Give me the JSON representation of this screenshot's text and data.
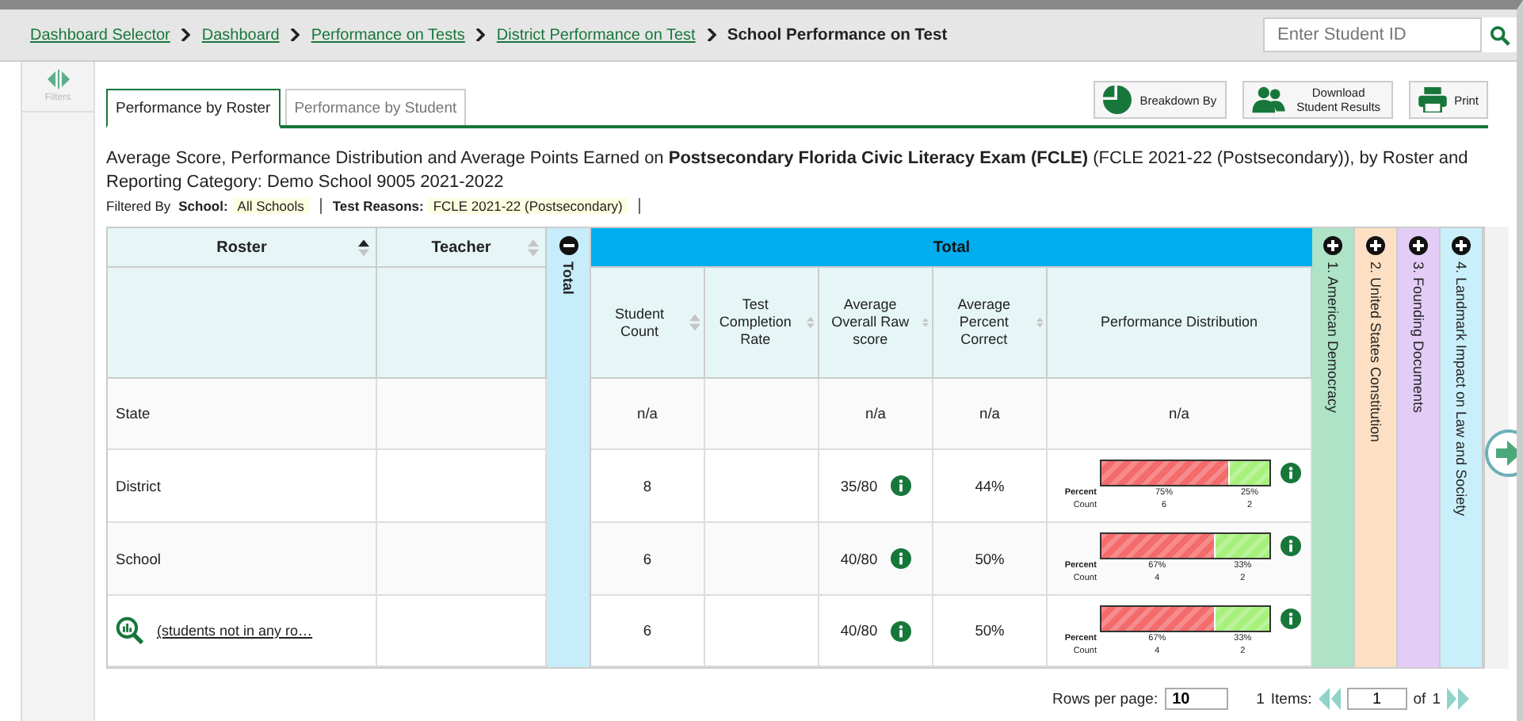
{
  "breadcrumb": [
    {
      "label": "Dashboard Selector",
      "kind": "link"
    },
    {
      "label": "Dashboard",
      "kind": "link"
    },
    {
      "label": "Performance on Tests",
      "kind": "link"
    },
    {
      "label": "District Performance on Test",
      "kind": "link"
    },
    {
      "label": "School Performance on Test",
      "kind": "current"
    }
  ],
  "student_search": {
    "placeholder": "Enter Student ID"
  },
  "sidebar": {
    "label": "Filters"
  },
  "tabs": [
    {
      "label": "Performance by Roster",
      "selected": true
    },
    {
      "label": "Performance by Student",
      "selected": false
    }
  ],
  "toolbar": [
    {
      "label": "Breakdown By",
      "kind": "breakdown"
    },
    {
      "label": "Download Student Results",
      "kind": "download"
    },
    {
      "label": "Print",
      "kind": "print"
    }
  ],
  "title": "Average Score, Performance Distribution and Average Points Earned on **Postsecondary Florida Civic Literacy Exam (FCLE)** (FCLE 2021-22 (Postsecondary)), by Roster and Reporting Category: Demo School 9005 2021-2022",
  "filters": {
    "label": "Filtered By",
    "items": [
      {
        "label": "School:",
        "value": "All Schools"
      },
      {
        "label": "Test Reasons:",
        "value": "FCLE 2021-22 (Postsecondary)"
      }
    ]
  },
  "table": {
    "roster_column": {
      "label": "Roster",
      "sorted": true
    },
    "teacher_column": {
      "label": "Teacher",
      "sorted": false
    },
    "total_group": {
      "label": "Total",
      "strip_label": "Total",
      "expanded": true
    },
    "columns": [
      {
        "label": "Student Count",
        "sortable": true
      },
      {
        "label": "Test Completion Rate",
        "sortable": true
      },
      {
        "label": "Average Overall Raw score",
        "sortable": true
      },
      {
        "label": "Average Percent Correct",
        "sortable": true
      },
      {
        "label": "Performance Distribution",
        "sortable": false
      }
    ],
    "categories": [
      {
        "label": "1. American Democracy",
        "color": "#aee3c8",
        "expanded": false
      },
      {
        "label": "2. United States Constitution",
        "color": "#fde0c4",
        "expanded": false
      },
      {
        "label": "3. Founding Documents",
        "color": "#e3cdf7",
        "expanded": false
      },
      {
        "label": "4. Landmark Impact on Law and Society",
        "color": "#c9effb",
        "expanded": false
      }
    ],
    "rows": [
      {
        "roster": "State",
        "kind": "aggregate",
        "student_count": "n/a",
        "raw_score": "n/a",
        "raw_info": false,
        "percent_correct": "n/a",
        "distribution_text": "n/a"
      },
      {
        "roster": "District",
        "kind": "aggregate",
        "student_count": "8",
        "raw_score": "35/80",
        "raw_info": true,
        "percent_correct": "44%",
        "distribution": {
          "percent_label": "Percent",
          "count_label": "Count",
          "segments": [
            {
              "level": 0.75,
              "color": "#f36b6b",
              "percent": "75%",
              "count": "6"
            },
            {
              "level": 0.25,
              "color": "#a6f07c",
              "percent": "25%",
              "count": "2"
            }
          ]
        }
      },
      {
        "roster": "School",
        "kind": "aggregate",
        "student_count": "6",
        "raw_score": "40/80",
        "raw_info": true,
        "percent_correct": "50%",
        "distribution": {
          "percent_label": "Percent",
          "count_label": "Count",
          "segments": [
            {
              "level": 0.67,
              "color": "#f36b6b",
              "percent": "67%",
              "count": "4"
            },
            {
              "level": 0.33,
              "color": "#a6f07c",
              "percent": "33%",
              "count": "2"
            }
          ]
        }
      },
      {
        "roster": "(students not in any ro…",
        "kind": "group",
        "student_count": "6",
        "raw_score": "40/80",
        "raw_info": true,
        "percent_correct": "50%",
        "distribution": {
          "percent_label": "Percent",
          "count_label": "Count",
          "segments": [
            {
              "level": 0.67,
              "color": "#f36b6b",
              "percent": "67%",
              "count": "4"
            },
            {
              "level": 0.33,
              "color": "#a6f07c",
              "percent": "33%",
              "count": "2"
            }
          ]
        }
      }
    ]
  },
  "pagination": {
    "rows_label": "Rows per page:",
    "rows_value": "10",
    "items_count": "1",
    "items_label": "Items:",
    "page_value": "1",
    "of_label": "of",
    "page_total": "1"
  }
}
